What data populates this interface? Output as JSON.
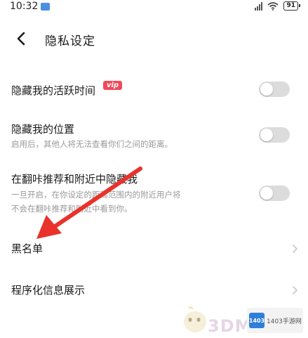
{
  "status_bar": {
    "time": "10:32",
    "battery": "91"
  },
  "header": {
    "title": "隐私设定"
  },
  "settings": [
    {
      "label": "隐藏我的活跃时间",
      "badge": "vip",
      "toggle_on": false
    },
    {
      "label": "隐藏我的位置",
      "description": "启用后，其他人将无法查看你们之间的距离。",
      "toggle_on": false
    },
    {
      "label": "在翻咔推荐和附近中隐藏我",
      "description_lines": [
        "一旦开启，在你设定的距离范围内的附近用户将",
        "不会在翻咔推荐和附近中看到你。"
      ],
      "toggle_on": false
    }
  ],
  "links": [
    {
      "label": "黑名单"
    },
    {
      "label": "程序化信息展示"
    }
  ],
  "watermark": {
    "logo_caption": "1403手游网",
    "logo_mark": "1403"
  },
  "colors": {
    "vip_badge": "#f04a5a",
    "annotation_arrow": "#e8322a",
    "toggle_off": "#dcdcdc"
  }
}
